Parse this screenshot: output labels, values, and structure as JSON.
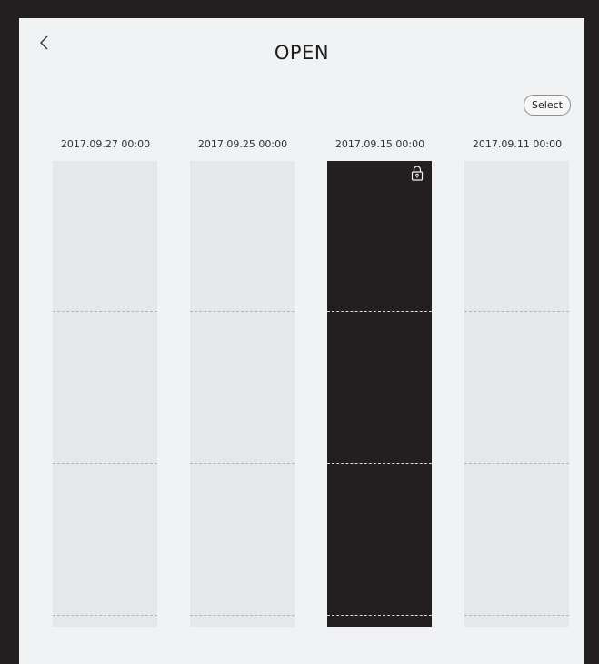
{
  "header": {
    "back_icon": "chevron-left-icon",
    "title": "OPEN",
    "select_label": "Select"
  },
  "items": [
    {
      "date": "2017.09.27 00:00",
      "locked": false,
      "style": "light"
    },
    {
      "date": "2017.09.25 00:00",
      "locked": false,
      "style": "light"
    },
    {
      "date": "2017.09.15 00:00",
      "locked": true,
      "style": "dark",
      "lock_icon": "lock-icon"
    },
    {
      "date": "2017.09.11 00:00",
      "locked": false,
      "style": "light"
    }
  ],
  "colors": {
    "frame": "#231f20",
    "background": "#f1f2f4",
    "thumbnail_light": "#e6e7e9",
    "thumbnail_dark": "#231f20"
  }
}
